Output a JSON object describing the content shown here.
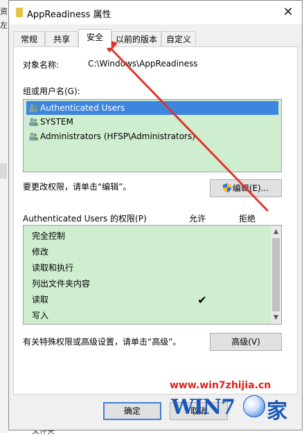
{
  "desktop": {
    "left_chars": [
      "资",
      "左"
    ],
    "bottom_text": "文件夹"
  },
  "window": {
    "title": "AppReadiness 属性",
    "close_glyph": "✕"
  },
  "tabs": [
    {
      "label": "常规"
    },
    {
      "label": "共享"
    },
    {
      "label": "安全"
    },
    {
      "label": "以前的版本"
    },
    {
      "label": "自定义"
    }
  ],
  "security": {
    "object_label": "对象名称:",
    "object_value": "C:\\Windows\\AppReadiness",
    "groups_label": "组或用户名(G):",
    "groups": [
      {
        "name": "Authenticated Users",
        "selected": true
      },
      {
        "name": "SYSTEM",
        "selected": false
      },
      {
        "name": "Administrators (HFSP\\Administrators)",
        "selected": false
      }
    ],
    "edit_hint": "要更改权限，请单击“编辑”。",
    "edit_button": "编辑(E)...",
    "perm_title": "Authenticated Users 的权限(P)",
    "perm_allow": "允许",
    "perm_deny": "拒绝",
    "permissions": [
      {
        "name": "完全控制",
        "allow": false
      },
      {
        "name": "修改",
        "allow": false
      },
      {
        "name": "读取和执行",
        "allow": false
      },
      {
        "name": "列出文件夹内容",
        "allow": false
      },
      {
        "name": "读取",
        "allow": true
      },
      {
        "name": "写入",
        "allow": false
      }
    ],
    "check_glyph": "✔",
    "adv_hint": "有关特殊权限或高级设置，请单击“高级”。",
    "adv_button": "高级(V)"
  },
  "footer": {
    "ok": "确定",
    "cancel": "取消"
  },
  "watermark": {
    "url": "www.win7zhijia.cn",
    "logo_text": "WIN7",
    "logo_suffix": "家"
  },
  "colors": {
    "list_bg": "#cfeed0",
    "selection": "#3d86e0",
    "arrow": "#e0342c"
  }
}
